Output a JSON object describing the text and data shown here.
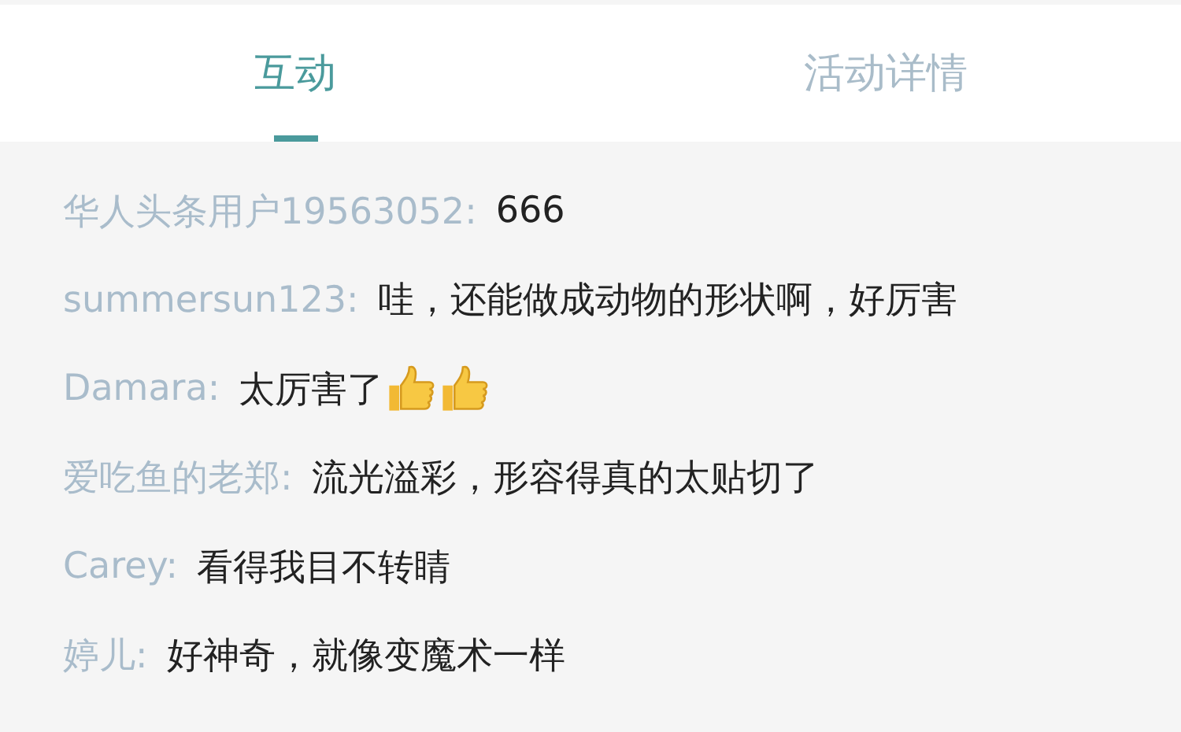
{
  "tabs": [
    {
      "label": "互动",
      "selected": true
    },
    {
      "label": "活动详情",
      "selected": false
    }
  ],
  "comments": [
    {
      "user": "华人头条用户19563052:",
      "text": "666"
    },
    {
      "user": "summersun123:",
      "text": "哇，还能做成动物的形状啊，好厉害"
    },
    {
      "user": "Damara:",
      "text": "太厉害了",
      "reactions": [
        {
          "kind": "thumbs_up"
        },
        {
          "kind": "thumbs_up"
        }
      ]
    },
    {
      "user": "爱吃鱼的老郑:",
      "text": "流光溢彩，形容得真的太贴切了"
    },
    {
      "user": "Carey:",
      "text": "看得我目不转睛"
    },
    {
      "user": "婷儿:",
      "text": "好神奇，就像变魔术一样"
    }
  ]
}
